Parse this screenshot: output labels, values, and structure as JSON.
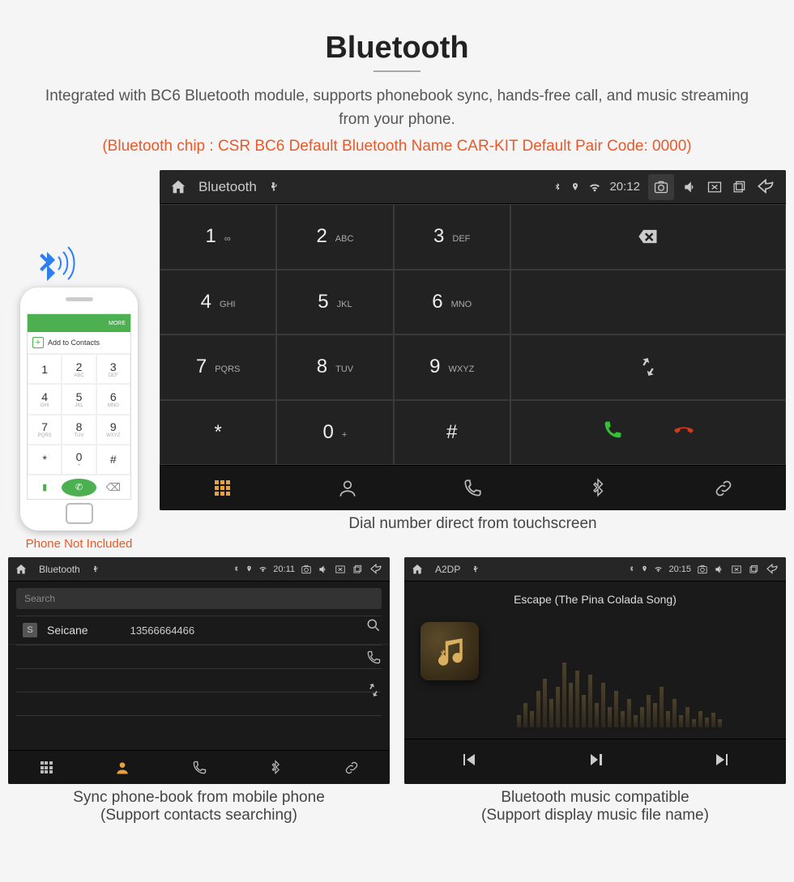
{
  "title": "Bluetooth",
  "description": "Integrated with BC6 Bluetooth module, supports phonebook sync, hands-free call, and music streaming from your phone.",
  "specs": "(Bluetooth chip : CSR BC6     Default Bluetooth Name CAR-KIT     Default Pair Code: 0000)",
  "phone": {
    "top_label": "MORE",
    "add_contacts": "Add to Contacts",
    "not_included": "Phone Not Included",
    "keys": [
      {
        "n": "1",
        "s": ""
      },
      {
        "n": "2",
        "s": "ABC"
      },
      {
        "n": "3",
        "s": "DEF"
      },
      {
        "n": "4",
        "s": "GHI"
      },
      {
        "n": "5",
        "s": "JKL"
      },
      {
        "n": "6",
        "s": "MNO"
      },
      {
        "n": "7",
        "s": "PQRS"
      },
      {
        "n": "8",
        "s": "TUV"
      },
      {
        "n": "9",
        "s": "WXYZ"
      },
      {
        "n": "*",
        "s": ""
      },
      {
        "n": "0",
        "s": "+"
      },
      {
        "n": "#",
        "s": ""
      }
    ]
  },
  "dialer": {
    "status": {
      "title": "Bluetooth",
      "time": "20:12"
    },
    "keys": [
      {
        "n": "1",
        "s": "∞"
      },
      {
        "n": "2",
        "s": "ABC"
      },
      {
        "n": "3",
        "s": "DEF"
      },
      {
        "n": "4",
        "s": "GHI"
      },
      {
        "n": "5",
        "s": "JKL"
      },
      {
        "n": "6",
        "s": "MNO"
      },
      {
        "n": "7",
        "s": "PQRS"
      },
      {
        "n": "8",
        "s": "TUV"
      },
      {
        "n": "9",
        "s": "WXYZ"
      },
      {
        "n": "*",
        "s": ""
      },
      {
        "n": "0",
        "s": "+"
      },
      {
        "n": "#",
        "s": ""
      }
    ],
    "caption": "Dial number direct from touchscreen"
  },
  "contacts": {
    "status": {
      "title": "Bluetooth",
      "time": "20:11"
    },
    "search_placeholder": "Search",
    "list": [
      {
        "badge": "S",
        "name": "Seicane",
        "number": "13566664466"
      }
    ],
    "caption1": "Sync phone-book from mobile phone",
    "caption2": "(Support contacts searching)"
  },
  "music": {
    "status": {
      "title": "A2DP",
      "time": "20:15"
    },
    "song": "Escape (The Pina Colada Song)",
    "caption1": "Bluetooth music compatible",
    "caption2": "(Support display music file name)"
  }
}
